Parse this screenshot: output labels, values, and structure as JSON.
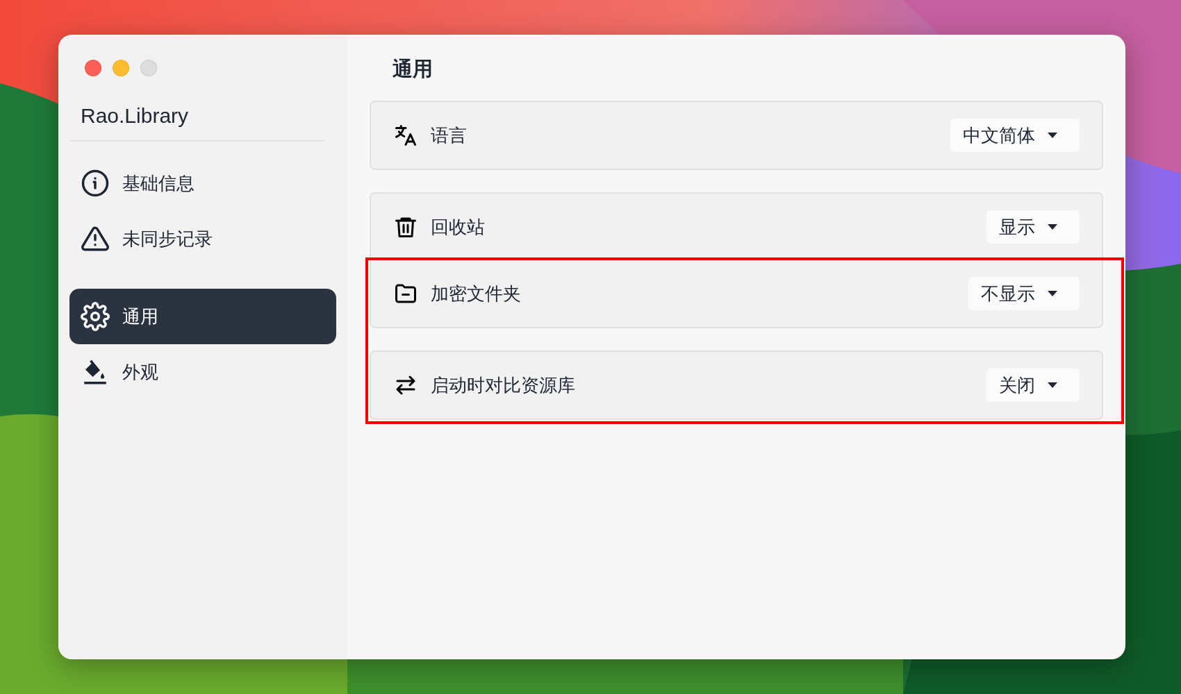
{
  "window": {
    "controls": [
      {
        "color": "#fe5f57"
      },
      {
        "color": "#febc2e"
      },
      {
        "color": "#dddddd"
      }
    ]
  },
  "sidebar": {
    "title": "Rao.Library",
    "sections": [
      {
        "items": [
          {
            "kind": "info",
            "label": "基础信息",
            "selected": false
          },
          {
            "kind": "warning",
            "label": "未同步记录",
            "selected": false
          }
        ]
      },
      {
        "items": [
          {
            "kind": "gear",
            "label": "通用",
            "selected": true
          },
          {
            "kind": "paint",
            "label": "外观",
            "selected": false
          }
        ]
      }
    ]
  },
  "page": {
    "title": "通用",
    "cards": [
      {
        "rows": [
          {
            "kind": "translate",
            "label": "语言",
            "value": "中文简体",
            "highlighted": false
          }
        ]
      },
      {
        "rows": [
          {
            "kind": "trash",
            "label": "回收站",
            "value": "显示",
            "highlighted": false
          },
          {
            "kind": "folder",
            "label": "加密文件夹",
            "value": "不显示",
            "highlighted": true
          }
        ]
      },
      {
        "rows": [
          {
            "kind": "swap",
            "label": "启动时对比资源库",
            "value": "关闭",
            "highlighted": true
          }
        ]
      }
    ]
  }
}
